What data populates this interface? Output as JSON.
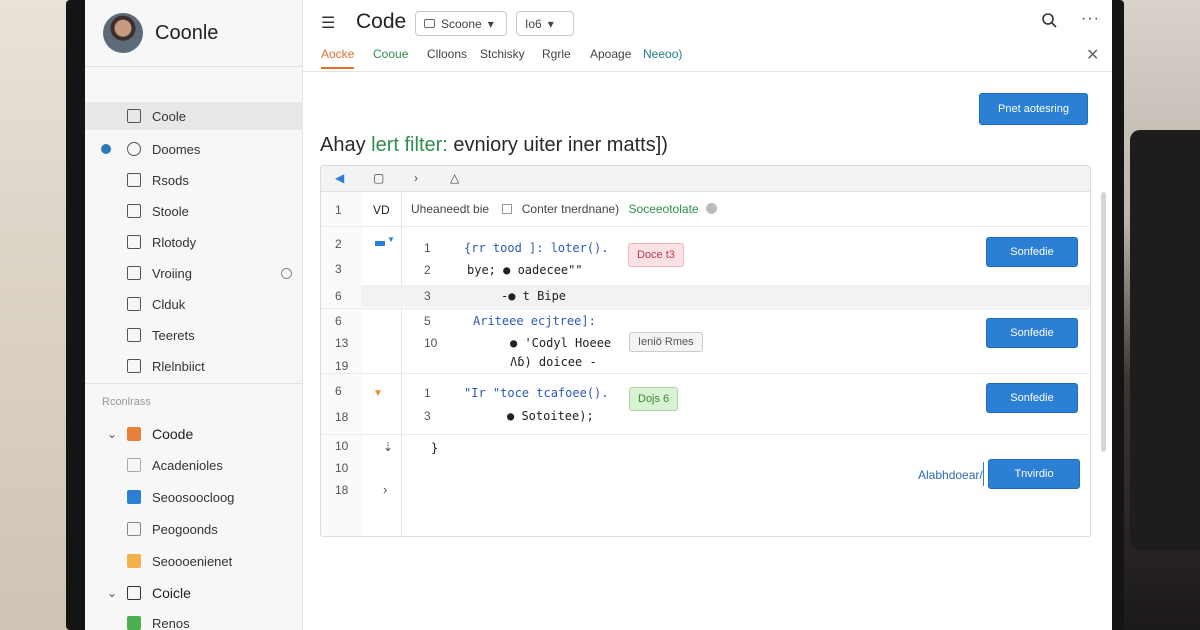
{
  "app": {
    "brand_name": "Coonle",
    "title": "Code",
    "dropdown_1": "Scoone",
    "dropdown_2": "Io6",
    "dropdown_chevron": "▾"
  },
  "sidebar": {
    "items": [
      {
        "label": "Coole",
        "icon": "document-icon"
      },
      {
        "label": "Doomes",
        "icon": "refresh-icon"
      },
      {
        "label": "Rsods",
        "icon": "list-icon"
      },
      {
        "label": "Stoole",
        "icon": "image-icon"
      },
      {
        "label": "Rlotody",
        "icon": "file-icon"
      },
      {
        "label": "Vroiing",
        "icon": "export-icon"
      },
      {
        "label": "Clduk",
        "icon": "doc-icon"
      },
      {
        "label": "Teerets",
        "icon": "doc-icon"
      },
      {
        "label": "Rlelnbiict",
        "icon": "doc-icon"
      }
    ],
    "section_label": "Rconlrass",
    "folders": [
      {
        "label": "Coode",
        "expanded": true,
        "color": "#e8823a"
      },
      {
        "label": "Acadenioles",
        "color": "#cccccc"
      },
      {
        "label": "Seoosoocloog",
        "color": "#2b7fd4"
      },
      {
        "label": "Peogoonds",
        "color": "#ffffff"
      },
      {
        "label": "Seoooenienet",
        "color": "#f2b14a"
      },
      {
        "label": "Coicle",
        "expanded": true,
        "color": "#333333"
      },
      {
        "label": "Renos",
        "color": "#4caf50"
      }
    ]
  },
  "tabs": [
    "Aocke",
    "Cooue",
    "Clloons",
    "Stchisky",
    "Rgrle",
    "Apoage",
    "Neeoo)"
  ],
  "main": {
    "primary_button": "Pnet aotesring",
    "heading_prefix": "Ahay",
    "heading_highlight": "lert filter:",
    "heading_suffix": "evniory uiter iner matts])"
  },
  "editor": {
    "header_id": "VD",
    "header_text": "Uheaneedt  bie",
    "header_option": "Conter  tnerdnane)",
    "header_link": "Soceeotolate",
    "rows": [
      {
        "gutter": [
          "2",
          "3"
        ],
        "lines": [
          "1",
          "2"
        ],
        "code": [
          "{rr tood ]: loter().",
          "bye; ● oadecee\"\""
        ],
        "tag": "Doce  t3",
        "button": "Sonfedie"
      },
      {
        "gutter": [
          "6"
        ],
        "lines": [
          "3"
        ],
        "code": [
          "-● t  Bipe"
        ]
      },
      {
        "gutter": [
          "6",
          "13",
          "19"
        ],
        "lines": [
          "5",
          "10"
        ],
        "code": [
          "Ariteee ecjtree]:",
          "● 'Codyl  Hoeee",
          "Ʌɓ) doicee -"
        ],
        "tag": "Ieniö Rmes",
        "button": "Sonfedie"
      },
      {
        "gutter": [
          "6",
          "18"
        ],
        "lines": [
          "1",
          "3"
        ],
        "code": [
          "\"Ir \"toce tcafoee().",
          "● Sotoitee);"
        ],
        "tag": "Dojs  6",
        "button": "Sonfedie"
      },
      {
        "gutter": [
          "10",
          "10",
          "18"
        ],
        "code": [
          "}"
        ],
        "link": "Alabhdoear/",
        "button": "Tnvirdio"
      }
    ]
  }
}
